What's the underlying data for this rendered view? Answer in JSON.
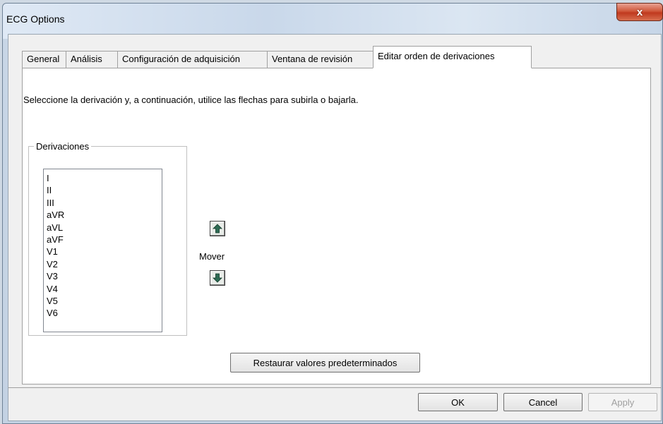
{
  "window": {
    "title": "ECG Options",
    "close_glyph": "x"
  },
  "tabs": [
    {
      "label": "General",
      "active": false
    },
    {
      "label": "Análisis",
      "active": false
    },
    {
      "label": "Configuración de adquisición",
      "active": false
    },
    {
      "label": "Ventana de revisión",
      "active": false
    },
    {
      "label": "Editar orden de derivaciones",
      "active": true
    }
  ],
  "panel": {
    "instruction": "Seleccione la derivación y, a continuación, utilice las flechas para subirla o bajarla.",
    "group_label": "Derivaciones",
    "leads": [
      "I",
      "II",
      "III",
      "aVR",
      "aVL",
      "aVF",
      "V1",
      "V2",
      "V3",
      "V4",
      "V5",
      "V6"
    ],
    "move_label": "Mover",
    "move_up_icon": "arrow-up-icon",
    "move_down_icon": "arrow-down-icon",
    "restore_button": "Restaurar valores predeterminados"
  },
  "footer": {
    "ok": "OK",
    "cancel": "Cancel",
    "apply": "Apply",
    "apply_enabled": false
  },
  "colors": {
    "close_button": "#c0391e",
    "arrow_fill": "#2e6b54"
  }
}
